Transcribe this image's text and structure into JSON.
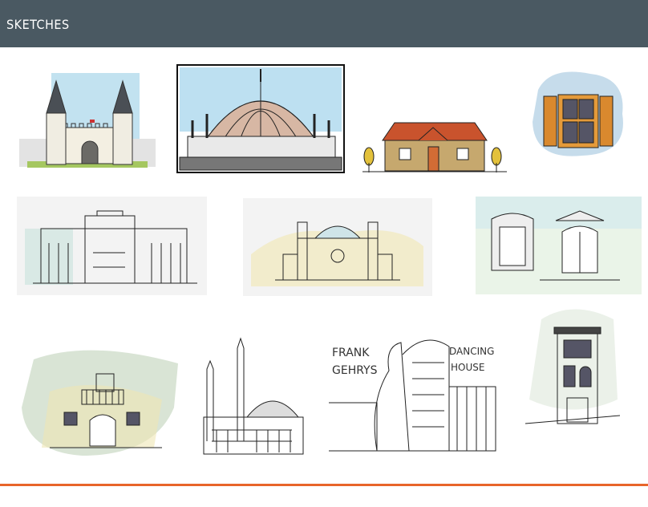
{
  "header": {
    "title": "SKETCHES"
  },
  "sketches": {
    "dancing_house": {
      "label_left_line1": "FRANK",
      "label_left_line2": "GEHRYS",
      "label_right_line1": "DANCING",
      "label_right_line2": "HOUSE"
    }
  },
  "colors": {
    "header_bg": "#4a5962",
    "accent_line": "#e8652a"
  }
}
